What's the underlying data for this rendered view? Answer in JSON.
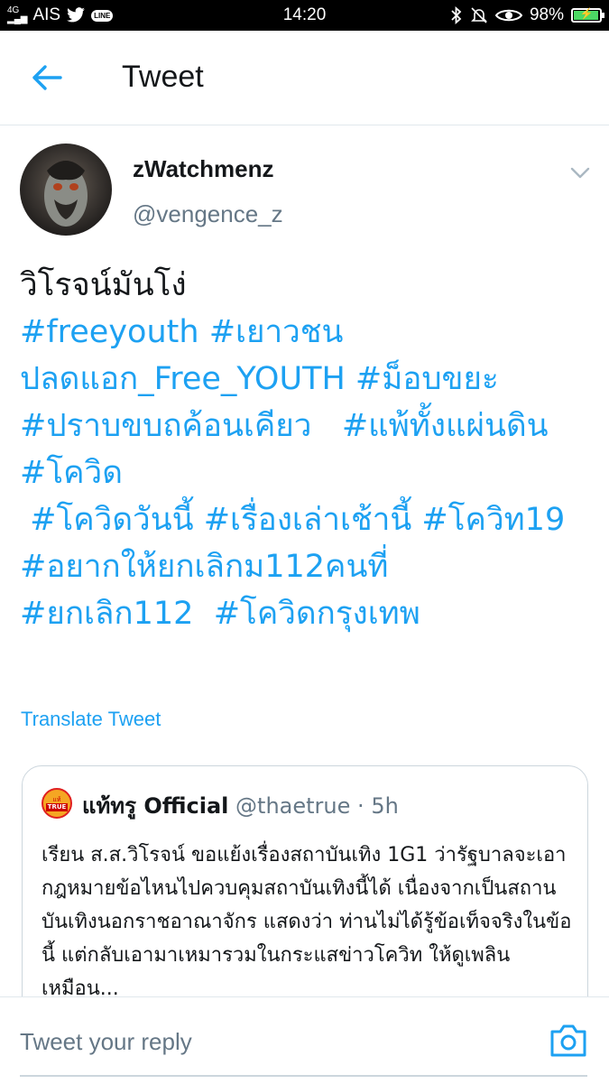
{
  "status_bar": {
    "signal": "4G",
    "carrier": "AIS",
    "line_label": "LINE",
    "time": "14:20",
    "battery": "98%",
    "battery_level": 0.98
  },
  "header": {
    "title": "Tweet"
  },
  "tweet": {
    "display_name": "zWatchmenz",
    "handle": "@vengence_z",
    "text": "วิโรจน์มันโง่",
    "hashtags": [
      "#freeyouth",
      "#เยาวชนปลดแอก_Free_YOUTH",
      "#ม็อบขยะ",
      "#ปราบขบถค้อนเคียว",
      "#แพ้ทั้งแผ่นดิน",
      "#โควิด",
      "#โควิดวันนี้",
      "#เรื่องเล่าเช้านี้",
      "#โควิท19",
      "#อยากให้ยกเลิกม112คนที่",
      "#ยกเลิก112",
      "#โควิดกรุงเทพ"
    ],
    "translate_label": "Translate Tweet"
  },
  "quoted_tweet": {
    "logo_text_top": "แท้",
    "logo_text_bottom": "TRUE",
    "name": "แท้ทรู Official",
    "handle": "@thaetrue",
    "separator": "·",
    "time": "5h",
    "text": "เรียน ส.ส.วิโรจน์ ขอแย้งเรื่องสถาบันเทิง 1G1 ว่ารัฐบาลจะเอากฎหมายข้อไหนไปควบคุมสถาบันเทิงนี้ได้ เนื่องจากเป็นสถานบันเทิงนอกราชอาณาจักร แสดงว่า ท่านไม่ได้รู้ข้อเท็จจริงในข้อนี้ แต่กลับเอามาเหมารวมในกระแสข่าวโควิท ให้ดูเพลินเหมือน..."
  },
  "reply": {
    "placeholder": "Tweet your reply"
  },
  "colors": {
    "accent": "#1da1f2",
    "text": "#14171a",
    "secondary": "#657786",
    "border": "#e1e8ed"
  },
  "icons": {
    "back": "arrow-left-icon",
    "caret": "chevron-down-icon",
    "camera": "camera-icon",
    "twitter": "twitter-bird-icon",
    "bluetooth": "bluetooth-icon",
    "mute": "bell-off-icon",
    "eye": "eye-icon"
  }
}
